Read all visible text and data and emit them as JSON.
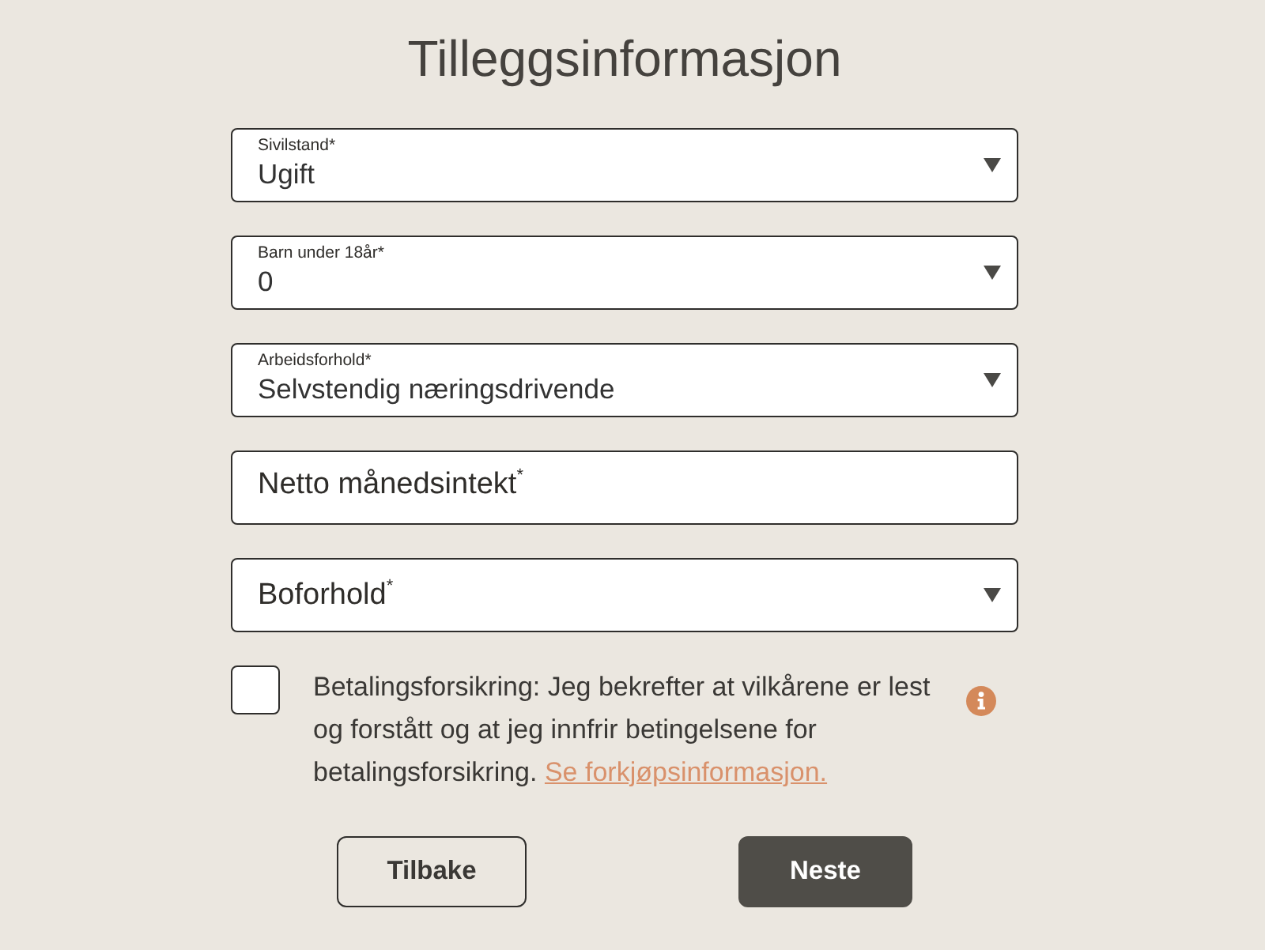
{
  "title": "Tilleggsinformasjon",
  "fields": [
    {
      "kind": "select",
      "label": "Sivilstand*",
      "value": "Ugift"
    },
    {
      "kind": "select",
      "label": "Barn under 18år*",
      "value": "0"
    },
    {
      "kind": "select",
      "label": "Arbeidsforhold*",
      "value": "Selvstendig næringsdrivende"
    },
    {
      "kind": "text",
      "label": "Netto månedsintekt$^{*}$"
    },
    {
      "kind": "select",
      "label": "Boforhold$^{*}$"
    }
  ],
  "consent": {
    "checked": false,
    "text": "Betalingsforsikring: Jeg bekrefter at vilkårene er lest og forstått og at jeg innfrir betingelsene for betalingsforsikring.",
    "link": "Se forkjøpsinformasjon."
  },
  "buttons": [
    {
      "kind": "outline",
      "label": "Tilbake"
    },
    {
      "kind": "filled",
      "label": "Neste"
    }
  ]
}
